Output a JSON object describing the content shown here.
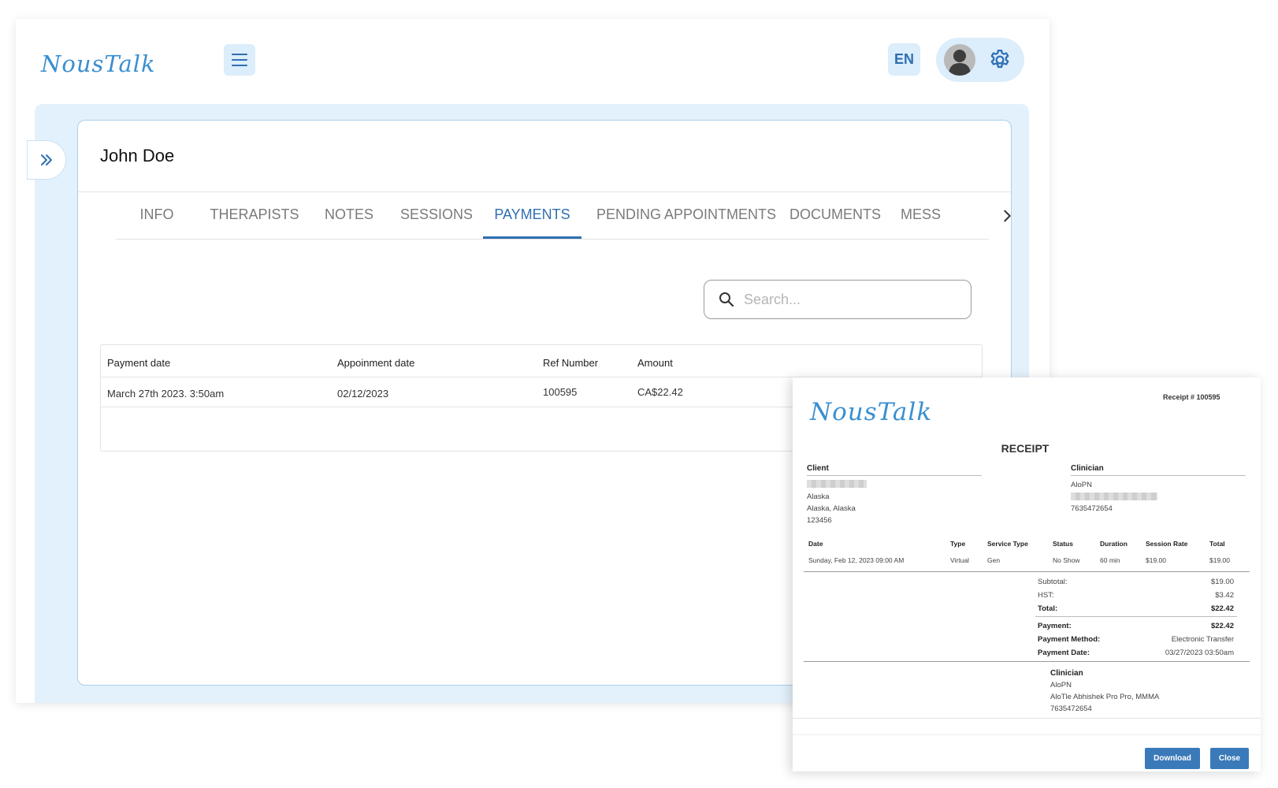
{
  "app": {
    "logo": "NousTalk",
    "language": "EN"
  },
  "client": {
    "name": "John Doe"
  },
  "tabs": [
    "INFO",
    "THERAPISTS",
    "NOTES",
    "SESSIONS",
    "PAYMENTS",
    "PENDING APPOINTMENTS",
    "DOCUMENTS",
    "MESS"
  ],
  "active_tab": "PAYMENTS",
  "search": {
    "placeholder": "Search..."
  },
  "payments_table": {
    "headers": [
      "Payment date",
      "Appoinment date",
      "Ref Number",
      "Amount"
    ],
    "rows": [
      [
        "March 27th 2023. 3:50am",
        "02/12/2023",
        "100595",
        "CA$22.42"
      ]
    ]
  },
  "receipt": {
    "logo": "NousTalk",
    "number": "Receipt # 100595",
    "title": "RECEIPT",
    "client_label": "Client",
    "client_lines": [
      "Alaska",
      "Alaska, Alaska",
      "123456"
    ],
    "clinician_label": "Clinician",
    "clinician_lines": [
      "AloPN",
      "7635472654"
    ],
    "line_headers": [
      "Date",
      "Type",
      "Service Type",
      "Status",
      "Duration",
      "Session Rate",
      "Total"
    ],
    "line_item": [
      "Sunday, Feb 12, 2023 09:00 AM",
      "Virtual",
      "Gen",
      "No Show",
      "60 min",
      "$19.00",
      "$19.00"
    ],
    "totals": {
      "subtotal_label": "Subtotal:",
      "subtotal": "$19.00",
      "hst_label": "HST:",
      "hst": "$3.42",
      "total_label": "Total:",
      "total": "$22.42"
    },
    "payment": {
      "payment_label": "Payment:",
      "payment": "$22.42",
      "method_label": "Payment Method:",
      "method": "Electronic Transfer",
      "date_label": "Payment Date:",
      "date": "03/27/2023 03:50am"
    },
    "footer_clinician": {
      "label": "Clinician",
      "lines": [
        "AloPN",
        "AloTle Abhishek Pro Pro, MMMA",
        "7635472654"
      ]
    },
    "buttons": {
      "download": "Download",
      "close": "Close"
    }
  },
  "colors": {
    "brand": "#3a8fd0",
    "accent": "#2f6fb3",
    "panel_bg": "#e3f1fc",
    "button_bg": "#3a7ab9"
  }
}
